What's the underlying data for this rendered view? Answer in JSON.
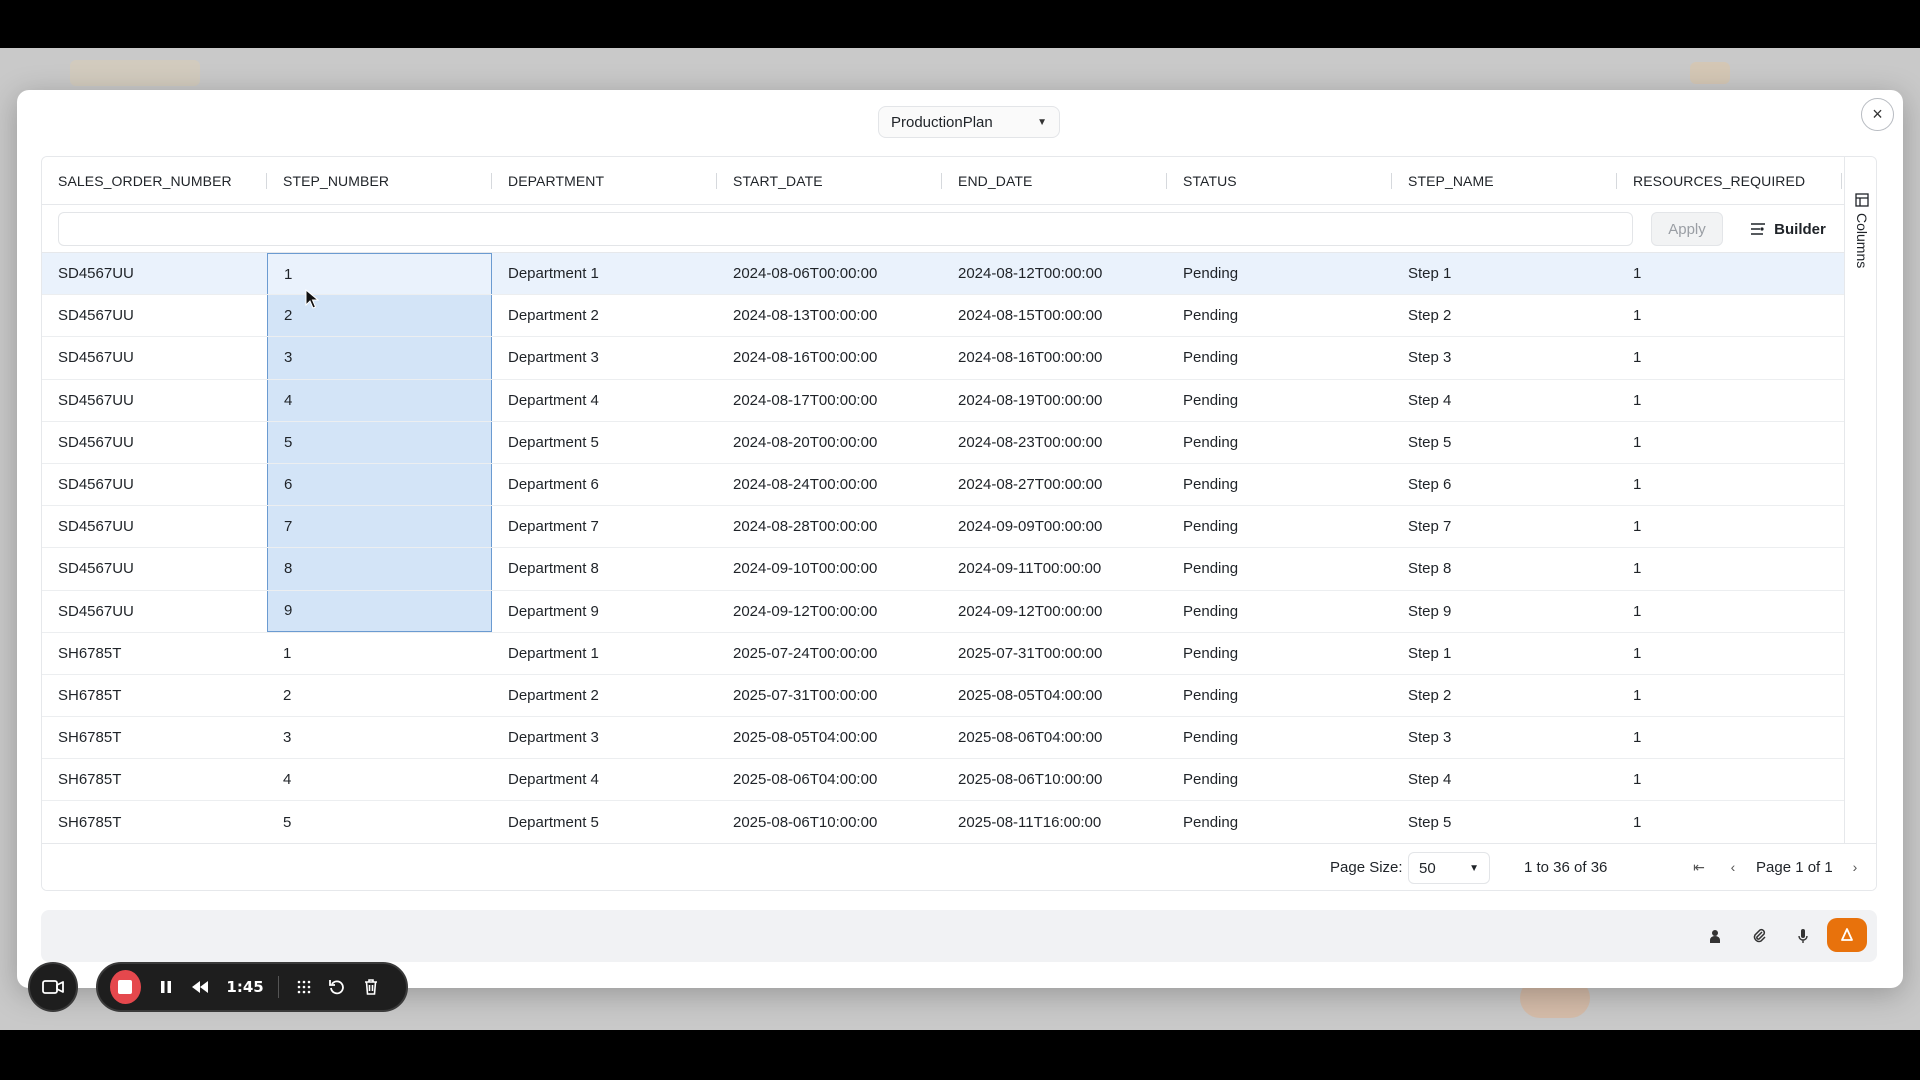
{
  "modal": {
    "source_select": {
      "value": "ProductionPlan"
    },
    "close_label": "×"
  },
  "grid": {
    "columns": [
      "SALES_ORDER_NUMBER",
      "STEP_NUMBER",
      "DEPARTMENT",
      "START_DATE",
      "END_DATE",
      "STATUS",
      "STEP_NAME",
      "RESOURCES_REQUIRED"
    ],
    "filter": {
      "value": "",
      "placeholder": ""
    },
    "apply_label": "Apply",
    "builder_label": "Builder",
    "side_panel": {
      "columns_label": "Columns"
    },
    "rows": [
      [
        "SD4567UU",
        "1",
        "Department 1",
        "2024-08-06T00:00:00",
        "2024-08-12T00:00:00",
        "Pending",
        "Step 1",
        "1"
      ],
      [
        "SD4567UU",
        "2",
        "Department 2",
        "2024-08-13T00:00:00",
        "2024-08-15T00:00:00",
        "Pending",
        "Step 2",
        "1"
      ],
      [
        "SD4567UU",
        "3",
        "Department 3",
        "2024-08-16T00:00:00",
        "2024-08-16T00:00:00",
        "Pending",
        "Step 3",
        "1"
      ],
      [
        "SD4567UU",
        "4",
        "Department 4",
        "2024-08-17T00:00:00",
        "2024-08-19T00:00:00",
        "Pending",
        "Step 4",
        "1"
      ],
      [
        "SD4567UU",
        "5",
        "Department 5",
        "2024-08-20T00:00:00",
        "2024-08-23T00:00:00",
        "Pending",
        "Step 5",
        "1"
      ],
      [
        "SD4567UU",
        "6",
        "Department 6",
        "2024-08-24T00:00:00",
        "2024-08-27T00:00:00",
        "Pending",
        "Step 6",
        "1"
      ],
      [
        "SD4567UU",
        "7",
        "Department 7",
        "2024-08-28T00:00:00",
        "2024-09-09T00:00:00",
        "Pending",
        "Step 7",
        "1"
      ],
      [
        "SD4567UU",
        "8",
        "Department 8",
        "2024-09-10T00:00:00",
        "2024-09-11T00:00:00",
        "Pending",
        "Step 8",
        "1"
      ],
      [
        "SD4567UU",
        "9",
        "Department 9",
        "2024-09-12T00:00:00",
        "2024-09-12T00:00:00",
        "Pending",
        "Step 9",
        "1"
      ],
      [
        "SH6785T",
        "1",
        "Department 1",
        "2025-07-24T00:00:00",
        "2025-07-31T00:00:00",
        "Pending",
        "Step 1",
        "1"
      ],
      [
        "SH6785T",
        "2",
        "Department 2",
        "2025-07-31T00:00:00",
        "2025-08-05T04:00:00",
        "Pending",
        "Step 2",
        "1"
      ],
      [
        "SH6785T",
        "3",
        "Department 3",
        "2025-08-05T04:00:00",
        "2025-08-06T04:00:00",
        "Pending",
        "Step 3",
        "1"
      ],
      [
        "SH6785T",
        "4",
        "Department 4",
        "2025-08-06T04:00:00",
        "2025-08-06T10:00:00",
        "Pending",
        "Step 4",
        "1"
      ],
      [
        "SH6785T",
        "5",
        "Department 5",
        "2025-08-06T10:00:00",
        "2025-08-11T16:00:00",
        "Pending",
        "Step 5",
        "1"
      ]
    ],
    "selected_row": 0,
    "selected_column": 1,
    "selected_range_rows": 9
  },
  "pager": {
    "page_size_label": "Page Size:",
    "page_size_value": "50",
    "range_text": "1 to 36 of 36",
    "page_text": "Page 1 of 1"
  },
  "chat_bar": {
    "icons": [
      "user-upload-icon",
      "paperclip-icon",
      "microphone-icon"
    ],
    "send_icon": "arrow-up-icon",
    "accent_color": "#e8720c"
  },
  "recorder": {
    "time": "1:45",
    "stop_color": "#e5484d"
  }
}
